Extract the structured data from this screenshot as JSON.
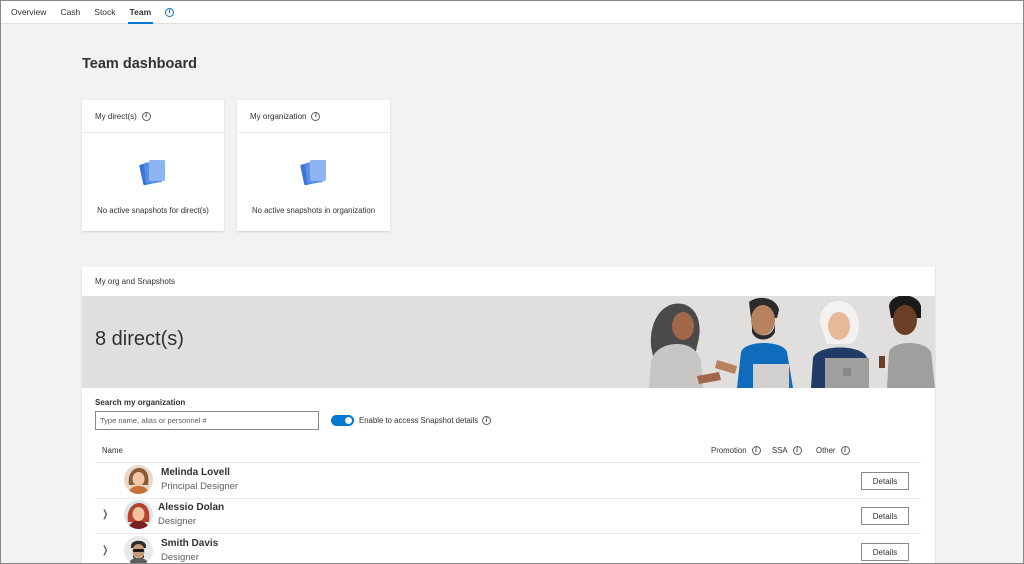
{
  "tabs": [
    {
      "label": "Overview"
    },
    {
      "label": "Cash"
    },
    {
      "label": "Stock"
    },
    {
      "label": "Team"
    }
  ],
  "active_tab": "Team",
  "page_title": "Team dashboard",
  "cards": [
    {
      "title": "My direct(s)",
      "message": "No active snapshots for direct(s)"
    },
    {
      "title": "My organization",
      "message": "No active snapshots in organization"
    }
  ],
  "org": {
    "title": "My org and Snapshots",
    "banner_text": "8 direct(s)",
    "search_label": "Search my organization",
    "search_placeholder": "Type name, alias or personnel #",
    "search_value": "",
    "toggle_label": "Enable to access Snapshot details",
    "toggle_on": true,
    "columns": {
      "name": "Name",
      "promotion": "Promotion",
      "ssa": "SSA",
      "other": "Other"
    },
    "people": [
      {
        "name": "Melinda Lovell",
        "role": "Principal Designer",
        "expandable": false,
        "details_label": "Details"
      },
      {
        "name": "Alessio Dolan",
        "role": "Designer",
        "expandable": true,
        "details_label": "Details"
      },
      {
        "name": "Smith Davis",
        "role": "Designer",
        "expandable": true,
        "details_label": "Details"
      }
    ]
  },
  "colors": {
    "accent": "#0078d4",
    "page_bg": "#f3f2f1",
    "banner_bg": "#e1dfdd",
    "snapshot_icon": "#5b8ee6"
  },
  "icons": {
    "info": "info-icon",
    "snapshot": "snapshot-cards-icon",
    "expand": "chevron-right-icon"
  }
}
